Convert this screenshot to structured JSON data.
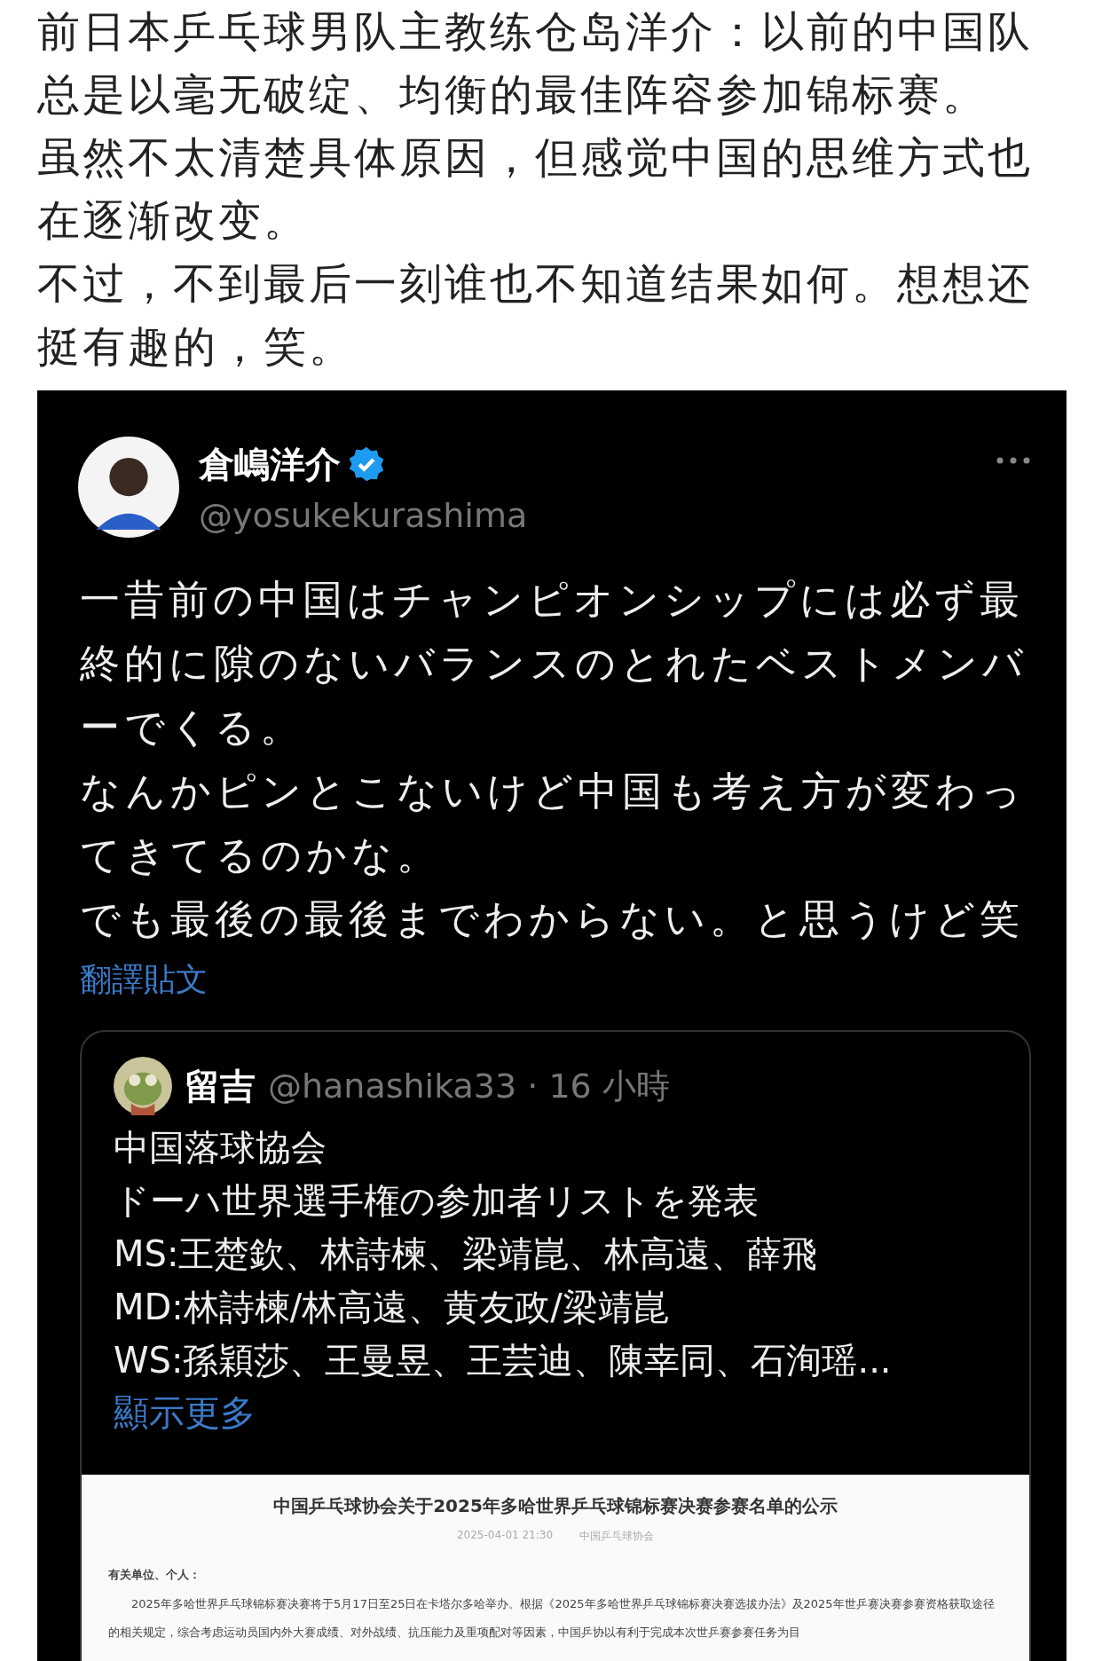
{
  "post": {
    "paragraphs": [
      "前日本乒乓球男队主教练仓岛洋介：以前的中国队总是以毫无破绽、均衡的最佳阵容参加锦标赛。",
      "虽然不太清楚具体原因，但感觉中国的思维方式也在逐渐改变。",
      "不过，不到最后一刻谁也不知道结果如何。想想还挺有趣的，笑。"
    ]
  },
  "tweet": {
    "name": "倉嶋洋介",
    "verified": true,
    "handle": "@yosukekurashima",
    "body": [
      "一昔前の中国はチャンピオンシップには必ず最終的に隙のないバランスのとれたベストメンバーでくる。",
      "なんかピンとこないけど中国も考え方が変わってきてるのかな。",
      "でも最後の最後までわからない。と思うけど笑"
    ],
    "translate_link": "翻譯貼文",
    "quote": {
      "name": "留吉",
      "meta": "@hanashika33 · 16 小時",
      "lines": [
        "中国落球協会",
        "ドーハ世界選手権の参加者リストを発表",
        "MS:王楚欽、林詩楝、梁靖崑、林高遠、薛飛",
        "MD:林詩楝/林高遠、黄友政/梁靖崑",
        "WS:孫穎莎、王曼昱、王芸迪、陳幸同、石洵瑶..."
      ],
      "show_more": "顯示更多",
      "document": {
        "title": "中国乒乓球协会关于2025年多哈世界乒乓球锦标赛决赛参赛名单的公示",
        "date": "2025-04-01 21:30",
        "source": "中国乒乓球协会",
        "greeting": "有关单位、个人：",
        "body": "2025年多哈世界乒乓球锦标赛决赛将于5月17日至25日在卡塔尔多哈举办。根据《2025年多哈世界乒乓球锦标赛决赛选拔办法》及2025年世乒赛决赛参赛资格获取途径的相关规定，综合考虑运动员国内外大赛成绩、对外战绩、抗压能力及重项配对等因素，中国乒协以有利于完成本次世乒赛参赛任务为目"
      }
    }
  }
}
